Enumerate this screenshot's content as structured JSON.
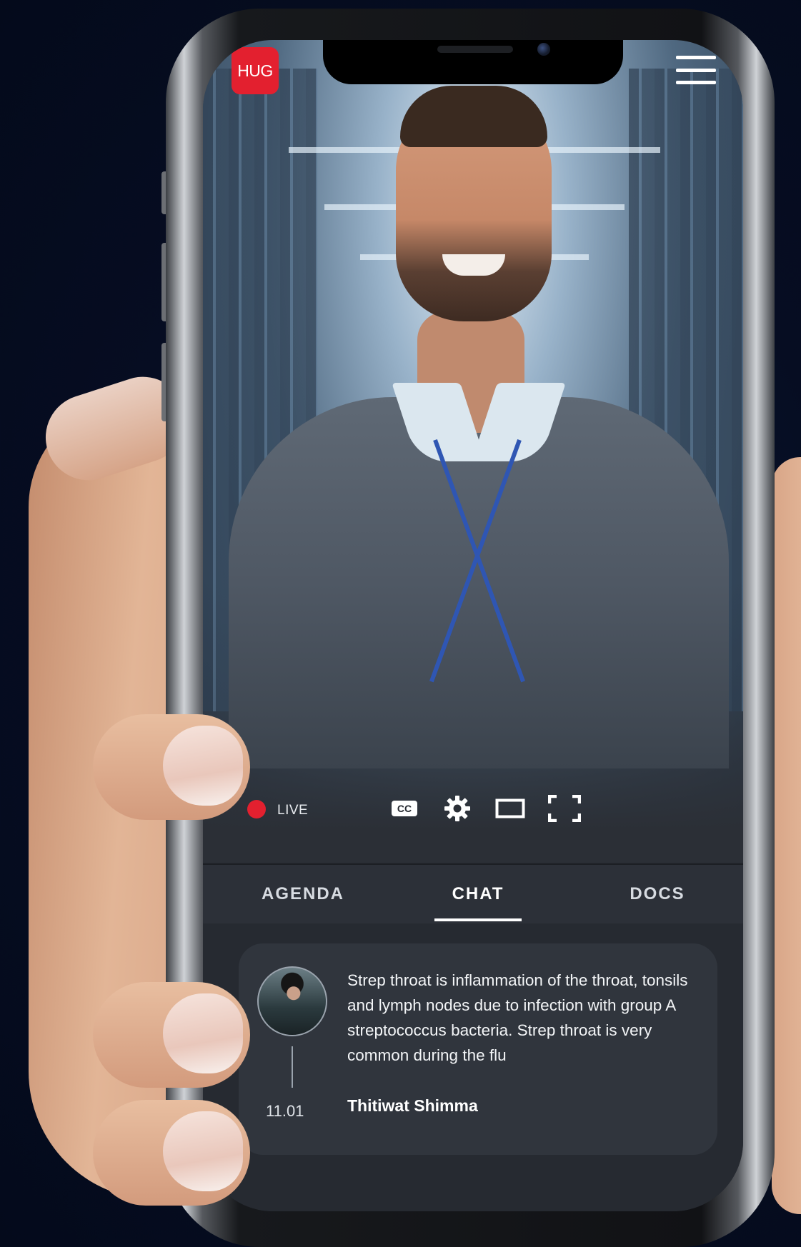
{
  "app": {
    "logo_text": "HUG",
    "menu_icon": "hamburger-menu-icon"
  },
  "player": {
    "live_label": "LIVE",
    "live_color": "#e3202f",
    "controls": {
      "captions_label": "CC",
      "settings_icon": "gear-icon",
      "theater_icon": "rectangle-icon",
      "fullscreen_icon": "fullscreen-corners-icon"
    }
  },
  "tabs": [
    {
      "label": "AGENDA",
      "active": false
    },
    {
      "label": "CHAT",
      "active": true
    },
    {
      "label": "DOCS",
      "active": false
    }
  ],
  "chat": {
    "messages": [
      {
        "avatar_icon": "user-avatar",
        "time": "11.01",
        "text": "Strep throat is inflammation of the throat, tonsils and lymph nodes due to infection with group A streptococcus bacteria. Strep throat is very common during the flu",
        "author": "Thitiwat Shimma"
      }
    ]
  },
  "colors": {
    "background": "#060d22",
    "screen_bg": "#262a31",
    "card_bg": "#30353d",
    "accent_red": "#e3202f",
    "tab_underline": "#ffffff"
  }
}
